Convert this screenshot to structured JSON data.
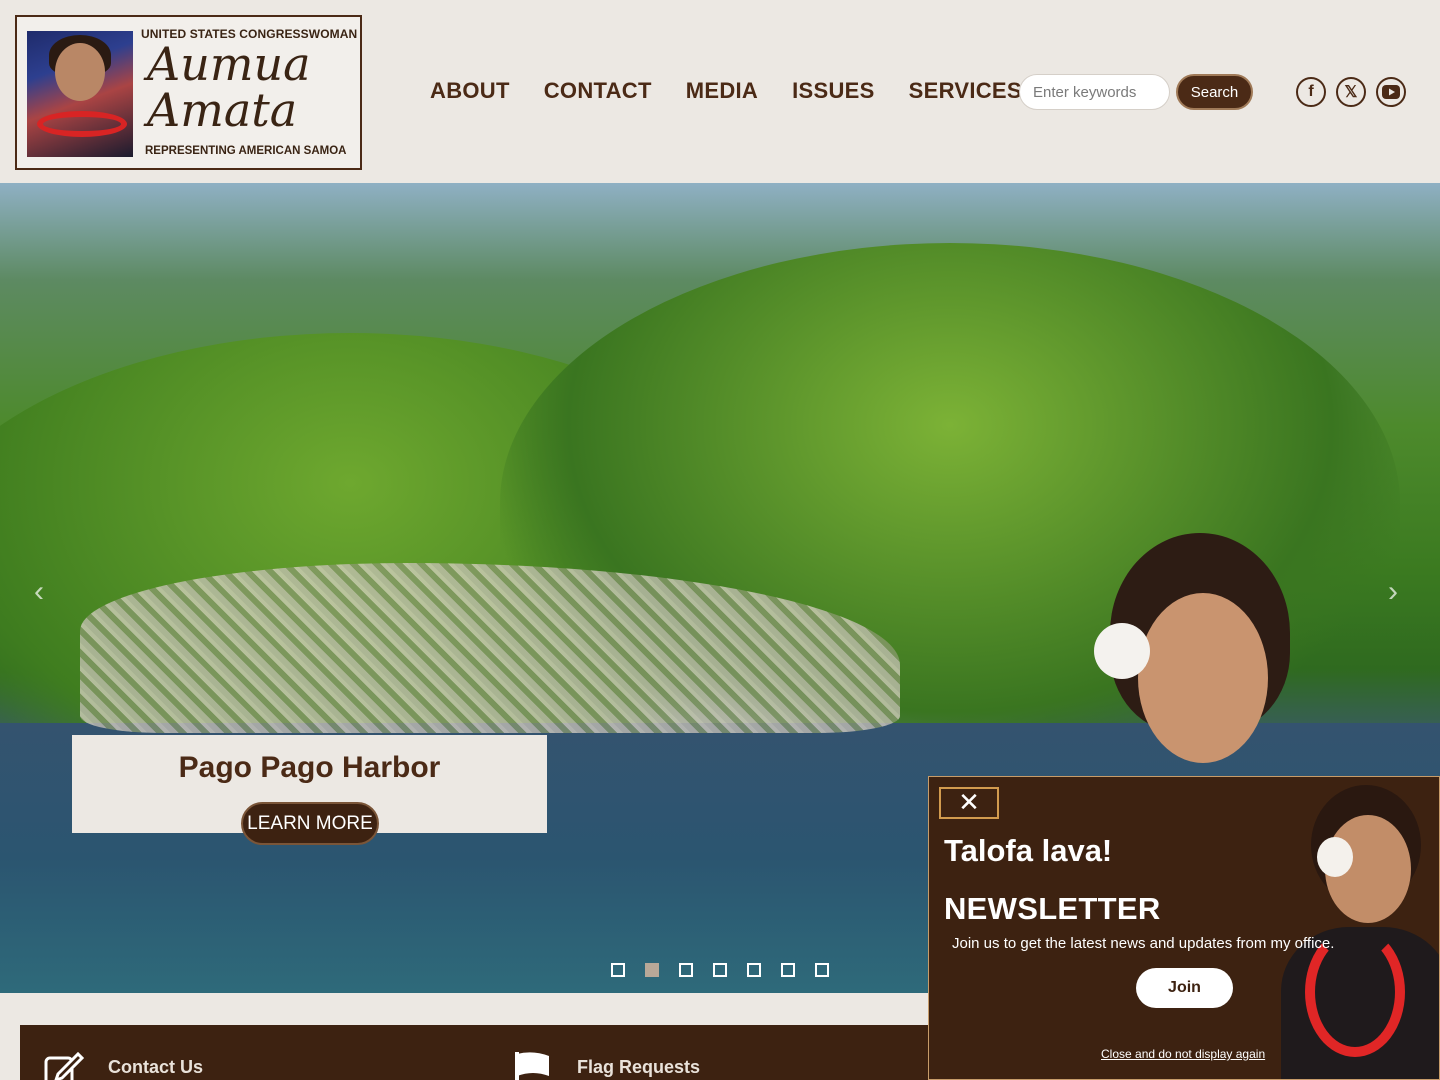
{
  "logo": {
    "top_text": "UNITED STATES CONGRESSWOMAN",
    "name": "Aumua Amata",
    "bottom_text": "REPRESENTING AMERICAN SAMOA"
  },
  "nav": {
    "items": [
      {
        "label": "ABOUT"
      },
      {
        "label": "CONTACT"
      },
      {
        "label": "MEDIA"
      },
      {
        "label": "ISSUES"
      },
      {
        "label": "SERVICES"
      }
    ]
  },
  "search": {
    "placeholder": "Enter keywords",
    "value": "",
    "button_label": "Search"
  },
  "social": {
    "icons": [
      "facebook-icon",
      "x-twitter-icon",
      "youtube-icon"
    ]
  },
  "hero": {
    "slide_title": "Pago Pago Harbor",
    "cta_label": "LEARN MORE",
    "slide_count": 7,
    "active_slide": 2
  },
  "quicklinks": {
    "items": [
      {
        "label": "Contact Us",
        "icon": "edit-icon"
      },
      {
        "label": "Flag Requests",
        "icon": "flag-icon"
      }
    ]
  },
  "popup": {
    "greeting": "Talofa lava!",
    "title": "NEWSLETTER",
    "description": "Join us to get the latest news and updates from my office.",
    "join_label": "Join",
    "dismiss_label": "Close and do not display again"
  },
  "colors": {
    "brand_brown": "#3d2211",
    "header_bg": "#ece8e3",
    "accent_gold": "#d29b4e"
  }
}
